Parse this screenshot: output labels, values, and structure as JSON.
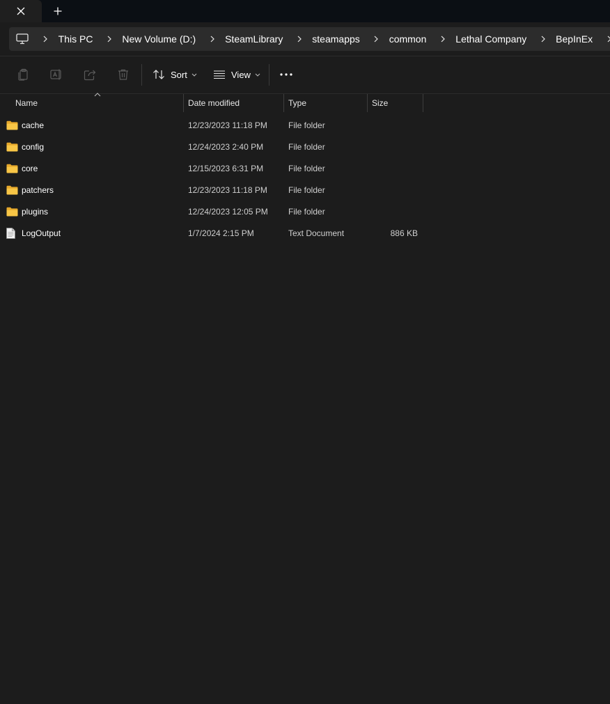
{
  "window": {
    "tab_close_icon": "close-icon",
    "new_tab_icon": "plus-icon"
  },
  "address_bar": {
    "root_icon": "computer-icon",
    "crumbs": [
      "This PC",
      "New Volume (D:)",
      "SteamLibrary",
      "steamapps",
      "common",
      "Lethal Company",
      "BepInEx"
    ]
  },
  "command_bar": {
    "copy_icon": "copy-icon",
    "rename_icon": "rename-icon",
    "share_icon": "share-icon",
    "delete_icon": "delete-icon",
    "sort_label": "Sort",
    "view_label": "View",
    "more_icon": "more-icon"
  },
  "columns": {
    "name": "Name",
    "date": "Date modified",
    "type": "Type",
    "size": "Size"
  },
  "files": [
    {
      "name": "cache",
      "date": "12/23/2023 11:18 PM",
      "type": "File folder",
      "size": "",
      "icon": "folder-icon"
    },
    {
      "name": "config",
      "date": "12/24/2023 2:40 PM",
      "type": "File folder",
      "size": "",
      "icon": "folder-icon"
    },
    {
      "name": "core",
      "date": "12/15/2023 6:31 PM",
      "type": "File folder",
      "size": "",
      "icon": "folder-icon"
    },
    {
      "name": "patchers",
      "date": "12/23/2023 11:18 PM",
      "type": "File folder",
      "size": "",
      "icon": "folder-icon"
    },
    {
      "name": "plugins",
      "date": "12/24/2023 12:05 PM",
      "type": "File folder",
      "size": "",
      "icon": "folder-icon"
    },
    {
      "name": "LogOutput",
      "date": "1/7/2024 2:15 PM",
      "type": "Text Document",
      "size": "886 KB",
      "icon": "text-document-icon"
    }
  ],
  "colors": {
    "background": "#1c1c1c",
    "titlebar": "#0b0f14",
    "address": "#2c2c2c",
    "folder": "#f8c646"
  }
}
